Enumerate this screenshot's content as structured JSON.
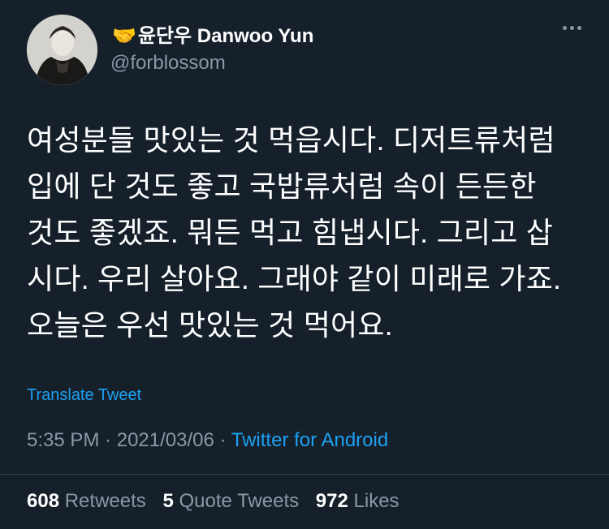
{
  "user": {
    "display_name": "윤단우 Danwoo Yun",
    "name_emoji": "🤝",
    "handle": "@forblossom"
  },
  "tweet": {
    "text": "여성분들 맛있는 것 먹읍시다. 디저트류처럼\n입에 단 것도 좋고 국밥류처럼 속이 든든한\n것도 좋겠죠. 뭐든 먹고 힘냅시다. 그리고 삽\n시다. 우리 살아요. 그래야 같이 미래로 가죠.\n오늘은 우선 맛있는 것 먹어요.",
    "translate_label": "Translate Tweet",
    "time": "5:35 PM",
    "date": "2021/03/06",
    "source": "Twitter for Android"
  },
  "stats": {
    "retweets_count": "608",
    "retweets_label": "Retweets",
    "quotes_count": "5",
    "quotes_label": "Quote Tweets",
    "likes_count": "972",
    "likes_label": "Likes"
  },
  "colors": {
    "background": "#15202b",
    "secondary_text": "#8899a6",
    "link": "#1da1f2",
    "divider": "#38444d"
  },
  "icons": {
    "more": "more-horizontal-icon"
  }
}
